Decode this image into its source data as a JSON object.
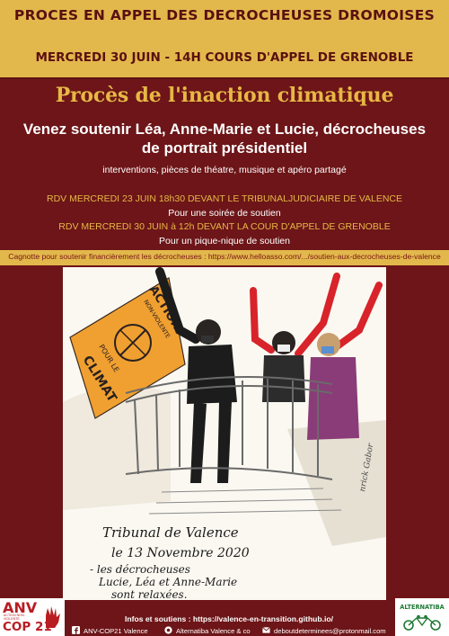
{
  "banner": {
    "title": "PROCES EN APPEL DES DECROCHEUSES DROMOISES",
    "subtitle": "MERCREDI 30 JUIN - 14H COURS D'APPEL DE GRENOBLE"
  },
  "main": {
    "title": "Procès de l'inaction climatique",
    "lead": "Venez soutenir Léa, Anne-Marie et Lucie, décrocheuses de portrait présidentiel",
    "activities": "interventions, pièces de théatre, musique et apéro partagé",
    "rdv1": "RDV MERCREDI 23 JUIN 18h30 DEVANT LE TRIBUNALJUDICIAIRE DE VALENCE",
    "rdv1_detail": "Pour une soirée de soutien",
    "rdv2": "RDV MERCREDI 30 JUIN à 12h DEVANT LA COUR D'APPEL DE GRENOBLE",
    "rdv2_detail": "Pour un pique-nique de soutien"
  },
  "cagnotte": "Cagnotte pour soutenir financièrement les décrocheuses : https://www.helloasso.com/.../soutien-aux-decrocheuses-de-valence",
  "drawing": {
    "banner_text_1": "ACTION",
    "banner_text_2": "NON-VIOLENTE",
    "banner_text_3": "POUR LE",
    "banner_text_4": "CLIMAT",
    "signature": "nrick Gabor",
    "caption_1": "Tribunal de Valence",
    "caption_2": "le 13 Novembre 2020",
    "caption_3": "- les décrocheuses",
    "caption_4": "Lucie, Léa et Anne-Marie",
    "caption_5": "sont relaxées."
  },
  "footer": {
    "info": "Infos et soutiens : https://valence-en-transition.github.io/",
    "facebook": "ANV-COP21 Valence",
    "alternatiba": "Alternatiba Valence & co",
    "email": "deboutdeterminees@protonmail.com",
    "anv_logo_top": "ANV",
    "anv_logo_bottom": "COP 21",
    "anv_logo_small": "ACTION NON-VIOLENTE",
    "alt_logo": "ALTERNATIBA"
  },
  "colors": {
    "background": "#6d1518",
    "gold": "#e2b84c",
    "title_gold": "#e6b845"
  }
}
